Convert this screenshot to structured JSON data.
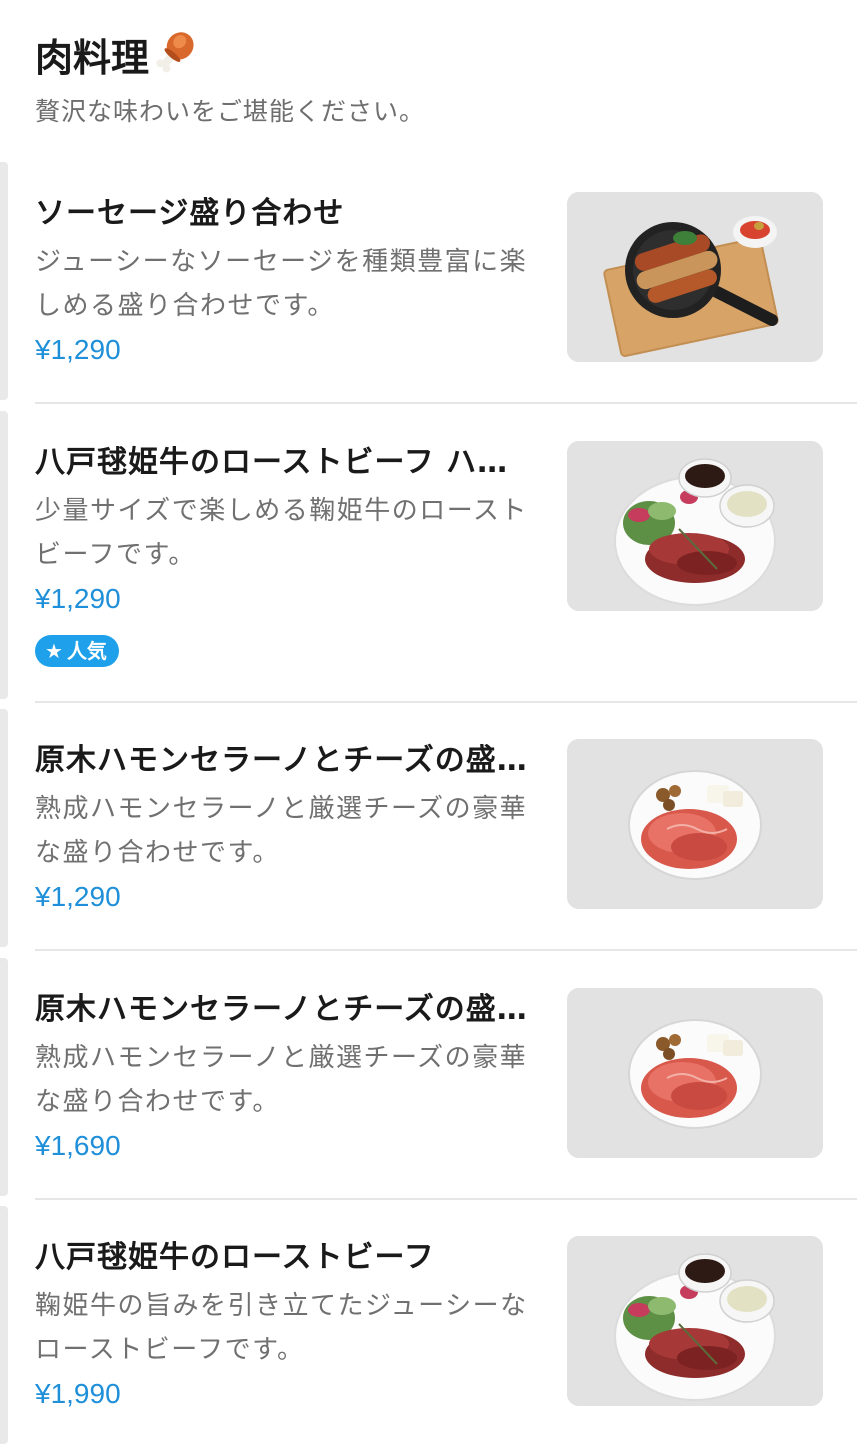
{
  "section": {
    "title": "肉料理",
    "title_icon": "meat-on-bone-icon",
    "subtitle": "贅沢な味わいをご堪能ください。"
  },
  "items": [
    {
      "name": "ソーセージ盛り合わせ",
      "description": "ジューシーなソーセージを種類豊富に楽しめる盛り合わせです。",
      "price": "¥1,290",
      "image": "sausage-platter-image"
    },
    {
      "name": "八戸毬姫牛のローストビーフ ハ…",
      "description": "少量サイズで楽しめる鞠姫牛のローストビーフです。",
      "price": "¥1,290",
      "badge": "人気",
      "badge_icon": "star-icon",
      "image": "roast-beef-image"
    },
    {
      "name": "原木ハモンセラーノとチーズの盛…",
      "description": "熟成ハモンセラーノと厳選チーズの豪華な盛り合わせです。",
      "price": "¥1,290",
      "image": "jamon-cheese-image"
    },
    {
      "name": "原木ハモンセラーノとチーズの盛…",
      "description": "熟成ハモンセラーノと厳選チーズの豪華な盛り合わせです。",
      "price": "¥1,690",
      "image": "jamon-cheese-image"
    },
    {
      "name": "八戸毬姫牛のローストビーフ",
      "description": "鞠姫牛の旨みを引き立てたジューシーなローストビーフです。",
      "price": "¥1,990",
      "image": "roast-beef-image"
    }
  ],
  "colors": {
    "price": "#1e8fd8",
    "badge": "#1ea0ea"
  }
}
